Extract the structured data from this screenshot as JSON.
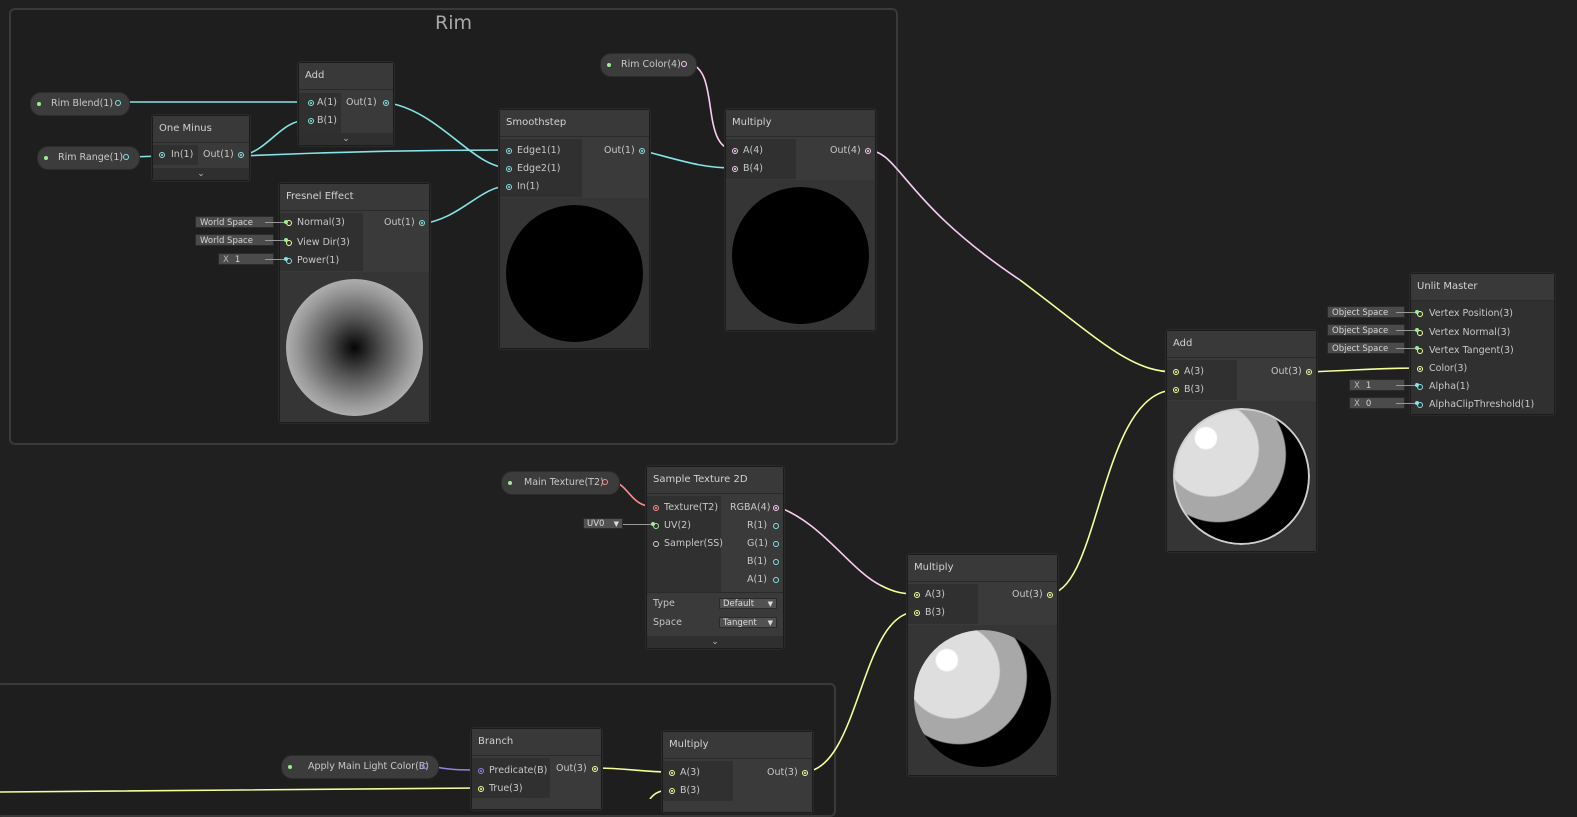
{
  "colors": {
    "background": "#202020",
    "wire_vector1": "#84e4e7",
    "wire_vector3": "#f6ff9a",
    "wire_vector4": "#fbcbf4",
    "wire_texture": "#ff8b8b",
    "wire_boolean": "#9481e6"
  },
  "groups": {
    "rim": {
      "title": "Rim"
    }
  },
  "properties": {
    "rim_blend": "Rim Blend(1)",
    "rim_range": "Rim Range(1)",
    "rim_color": "Rim Color(4)",
    "main_texture": "Main Texture(T2)",
    "apply_main_light": "Apply Main Light Color(B)"
  },
  "nodes": {
    "add_rim": {
      "title": "Add",
      "in_a": "A(1)",
      "in_b": "B(1)",
      "out": "Out(1)"
    },
    "one_minus": {
      "title": "One Minus",
      "in": "In(1)",
      "out": "Out(1)"
    },
    "fresnel": {
      "title": "Fresnel Effect",
      "in_normal": "Normal(3)",
      "in_viewdir": "View Dir(3)",
      "in_power": "Power(1)",
      "out": "Out(1)",
      "normal_default": "World Space",
      "viewdir_default": "World Space",
      "power_tag": "X",
      "power_value": "1"
    },
    "smoothstep": {
      "title": "Smoothstep",
      "in_edge1": "Edge1(1)",
      "in_edge2": "Edge2(1)",
      "in_in": "In(1)",
      "out": "Out(1)"
    },
    "multiply_rim": {
      "title": "Multiply",
      "in_a": "A(4)",
      "in_b": "B(4)",
      "out": "Out(4)"
    },
    "add_final": {
      "title": "Add",
      "in_a": "A(3)",
      "in_b": "B(3)",
      "out": "Out(3)"
    },
    "unlit_master": {
      "title": "Unlit Master",
      "ports": [
        "Vertex Position(3)",
        "Vertex Normal(3)",
        "Vertex Tangent(3)",
        "Color(3)",
        "Alpha(1)",
        "AlphaClipThreshold(1)"
      ],
      "pos_default": "Object Space",
      "normal_default": "Object Space",
      "tangent_default": "Object Space",
      "alpha_tag": "X",
      "alpha_value": "1",
      "clip_tag": "X",
      "clip_value": "0"
    },
    "sample_texture": {
      "title": "Sample Texture 2D",
      "in_texture": "Texture(T2)",
      "in_uv": "UV(2)",
      "in_sampler": "Sampler(SS)",
      "out_rgba": "RGBA(4)",
      "out_r": "R(1)",
      "out_g": "G(1)",
      "out_b": "B(1)",
      "out_a": "A(1)",
      "uv_default": "UV0",
      "type_label": "Type",
      "type_value": "Default",
      "space_label": "Space",
      "space_value": "Tangent"
    },
    "multiply_tex": {
      "title": "Multiply",
      "in_a": "A(3)",
      "in_b": "B(3)",
      "out": "Out(3)"
    },
    "branch": {
      "title": "Branch",
      "in_pred": "Predicate(B)",
      "in_true": "True(3)",
      "out": "Out(3)"
    },
    "multiply_light": {
      "title": "Multiply",
      "in_a": "A(3)",
      "in_b": "B(3)",
      "out": "Out(3)"
    }
  }
}
